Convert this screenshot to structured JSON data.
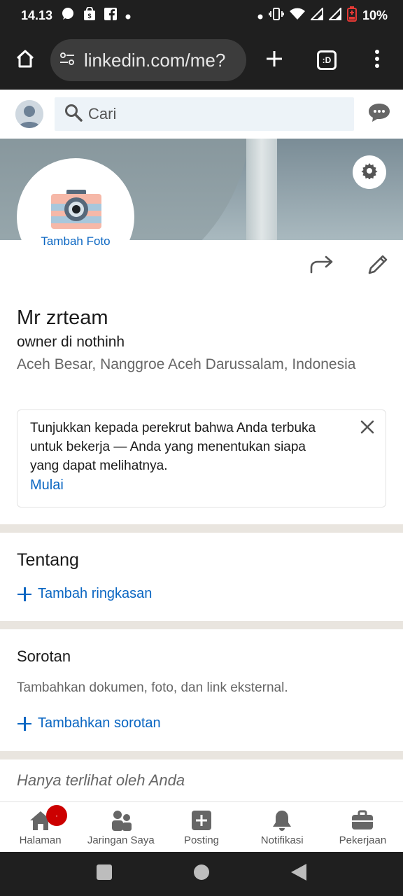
{
  "status_bar": {
    "time": "14.13",
    "battery": "10%"
  },
  "browser": {
    "url": "linkedin.com/me?",
    "tabs_label": ":D"
  },
  "header": {
    "search_placeholder": "Cari"
  },
  "profile": {
    "add_photo_label": "Tambah Foto",
    "name": "Mr zrteam",
    "headline": "owner di nothinh",
    "location": "Aceh Besar, Nanggroe Aceh Darussalam, Indonesia"
  },
  "open_to_work": {
    "text": "Tunjukkan kepada perekrut bahwa Anda terbuka untuk bekerja — Anda yang menentukan siapa yang dapat melihatnya.",
    "cta": "Mulai"
  },
  "about": {
    "title": "Tentang",
    "add_label": "Tambah ringkasan"
  },
  "featured": {
    "title": "Sorotan",
    "description": "Tambahkan dokumen, foto, dan link eksternal.",
    "add_label": "Tambahkan sorotan"
  },
  "private_section": {
    "title": "Hanya terlihat oleh Anda"
  },
  "bottom_nav": {
    "items": [
      {
        "label": "Halaman",
        "icon": "home-icon"
      },
      {
        "label": "Jaringan Saya",
        "icon": "network-icon"
      },
      {
        "label": "Posting",
        "icon": "post-icon"
      },
      {
        "label": "Notifikasi",
        "icon": "bell-icon"
      },
      {
        "label": "Pekerjaan",
        "icon": "briefcase-icon"
      }
    ]
  },
  "colors": {
    "link_blue": "#0a66c2",
    "notification_red": "#cc0000",
    "divider": "#e9e5df"
  }
}
